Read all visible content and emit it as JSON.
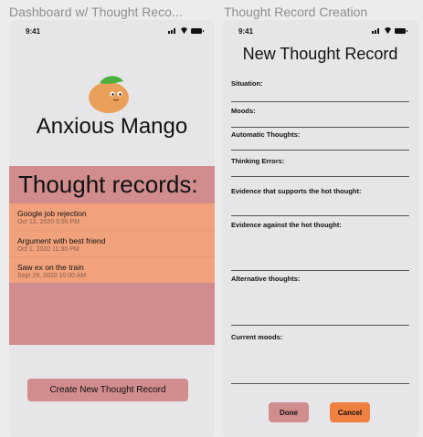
{
  "frames": {
    "left_label": "Dashboard w/ Thought Reco...",
    "right_label": "Thought Record Creation"
  },
  "status_bar": {
    "time": "9:41"
  },
  "dashboard": {
    "app_name": "Anxious Mango",
    "records_heading": "Thought records:",
    "records": [
      {
        "title": "Google job rejection",
        "date": "Oct 12, 2020 5:55 PM"
      },
      {
        "title": "Argument with best friend",
        "date": "Oct 1, 2020 11:30 PM"
      },
      {
        "title": "Saw ex on the train",
        "date": "Sept 29, 2020 10:00 AM"
      }
    ],
    "create_button": "Create New Thought Record",
    "colors": {
      "panel": "#d18c8e",
      "rows": "#f1a27d",
      "mango": "#e8a05a",
      "leaf": "#4caf3e"
    }
  },
  "form": {
    "title": "New Thought Record",
    "fields": [
      {
        "label": "Situation:"
      },
      {
        "label": "Moods:"
      },
      {
        "label": "Automatic Thoughts:"
      },
      {
        "label": "Thinking Errors:"
      },
      {
        "label": "Evidence that supports the hot thought:"
      },
      {
        "label": "Evidence against the hot thought:"
      },
      {
        "label": "Alternative thoughts:"
      },
      {
        "label": "Current moods:"
      }
    ],
    "done_label": "Done",
    "cancel_label": "Cancel",
    "colors": {
      "done": "#d18c8e",
      "cancel": "#f08040"
    }
  }
}
